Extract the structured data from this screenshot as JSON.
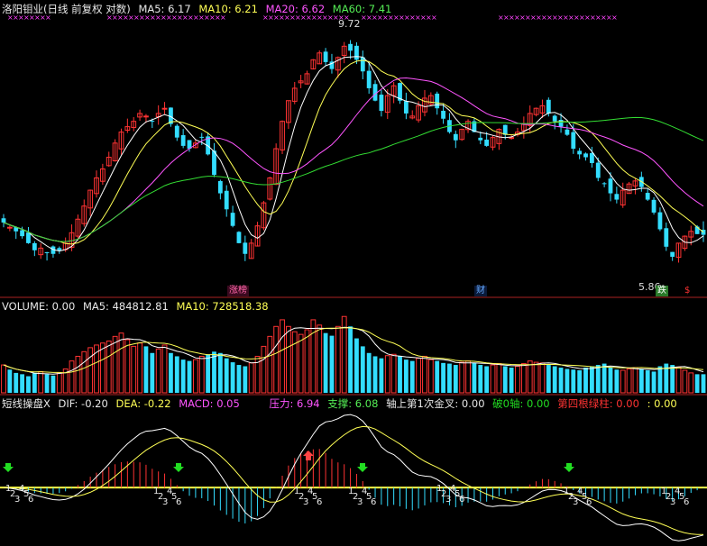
{
  "chart_data": [
    {
      "type": "candlestick",
      "header": {
        "name": "洛阳钼业(日线 前复权 对数)",
        "ma5_label": "MA5: 6.17",
        "ma10_label": "MA10: 6.21",
        "ma20_label": "MA20: 6.62",
        "ma60_label": "MA60: 7.41"
      },
      "scale": "log",
      "y_range": [
        5.5,
        10.3
      ],
      "high_mark": "9.72",
      "low_mark": "5.86",
      "tags": {
        "zhangting": "涨榜",
        "cai": "财",
        "die": "跌",
        "dollar": "$"
      },
      "colors": {
        "up": "#ff3333",
        "down": "#33ddff",
        "ma5": "#ffffff",
        "ma10": "#ffff55",
        "ma20": "#ff55ff",
        "ma60": "#33dd33"
      },
      "close": [
        6.35,
        6.28,
        6.22,
        6.15,
        6.05,
        5.95,
        5.98,
        5.92,
        5.9,
        5.95,
        6.05,
        6.2,
        6.4,
        6.6,
        6.85,
        7.05,
        7.2,
        7.4,
        7.65,
        7.85,
        7.95,
        8.05,
        8.2,
        8.15,
        8.05,
        8.2,
        8.3,
        8.0,
        7.75,
        7.6,
        7.55,
        7.65,
        7.75,
        7.45,
        7.1,
        6.8,
        6.55,
        6.3,
        6.05,
        5.9,
        6.05,
        6.3,
        6.65,
        7.05,
        7.55,
        8.05,
        8.45,
        8.7,
        8.85,
        9.0,
        9.3,
        9.45,
        9.25,
        9.1,
        9.35,
        9.6,
        9.5,
        9.3,
        9.05,
        8.7,
        8.45,
        8.25,
        8.55,
        8.75,
        8.45,
        8.2,
        8.15,
        8.35,
        8.5,
        8.55,
        8.3,
        8.1,
        7.85,
        7.7,
        7.9,
        8.05,
        7.85,
        7.7,
        7.6,
        7.75,
        7.9,
        7.8,
        7.75,
        7.85,
        8.0,
        8.2,
        8.3,
        8.35,
        8.2,
        8.05,
        7.95,
        7.8,
        7.55,
        7.45,
        7.4,
        7.3,
        7.05,
        6.95,
        6.8,
        6.7,
        6.85,
        6.95,
        7.0,
        6.9,
        6.7,
        6.5,
        6.25,
        6.0,
        5.86,
        6.05,
        6.15,
        6.22,
        6.18,
        6.17
      ],
      "volume_header": {
        "volume_label": "VOLUME: 0.00",
        "ma5_label": "MA5: 484812.81",
        "ma10_label": "MA10: 728518.38"
      },
      "volume": [
        42,
        35,
        30,
        28,
        25,
        30,
        32,
        28,
        26,
        30,
        36,
        48,
        55,
        62,
        68,
        72,
        75,
        78,
        85,
        90,
        80,
        70,
        75,
        70,
        60,
        66,
        72,
        60,
        55,
        50,
        48,
        50,
        55,
        58,
        62,
        60,
        52,
        46,
        42,
        40,
        45,
        55,
        70,
        85,
        100,
        110,
        100,
        92,
        88,
        95,
        110,
        102,
        90,
        86,
        100,
        115,
        100,
        82,
        70,
        60,
        55,
        52,
        56,
        58,
        55,
        50,
        48,
        52,
        55,
        50,
        48,
        45,
        44,
        42,
        46,
        48,
        45,
        42,
        40,
        42,
        44,
        40,
        38,
        40,
        44,
        48,
        46,
        45,
        42,
        40,
        38,
        36,
        35,
        34,
        38,
        40,
        42,
        44,
        38,
        35,
        34,
        36,
        38,
        36,
        34,
        32,
        40,
        44,
        42,
        38,
        34,
        30,
        28,
        28
      ],
      "macd_header": {
        "name": "短线操盘X",
        "dif_label": "DIF: -0.20",
        "dea_label": "DEA: -0.22",
        "macd_label": "MACD: 0.05",
        "pressure_label": "压力: 6.94",
        "support_label": "支撑: 6.08",
        "first_cross_label": "轴上第1次金叉: 0.00",
        "break_label": "破0轴: 0.00",
        "fourth_green_label": "第四根绿柱: 0.00",
        "extra_label": ": 0.00"
      },
      "macd_range": [
        -0.62,
        0.85
      ],
      "sequence_labels": [
        "1",
        "2",
        "3",
        "4",
        "5",
        "6"
      ]
    }
  ]
}
